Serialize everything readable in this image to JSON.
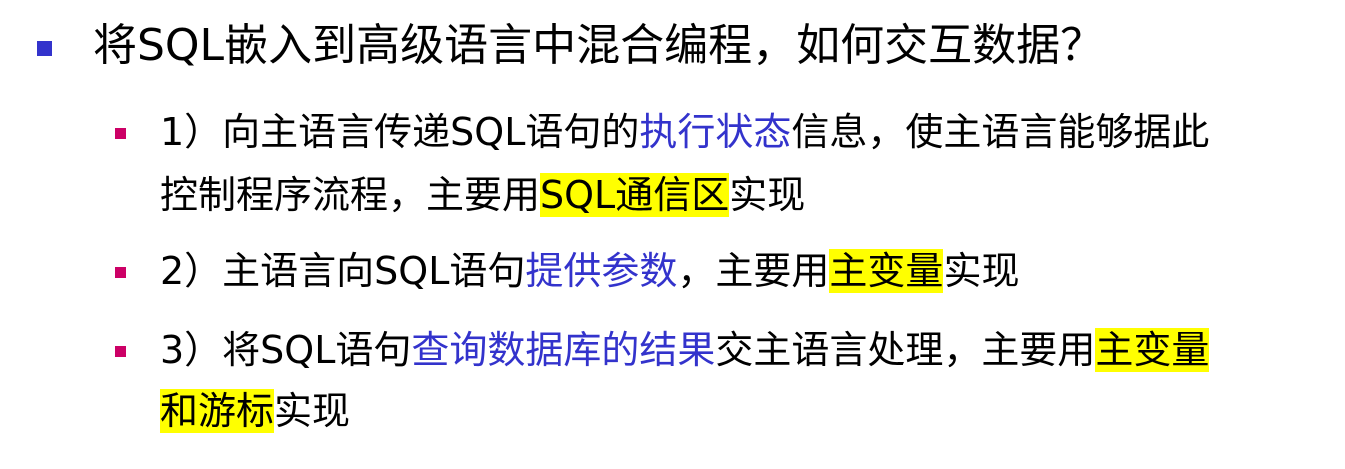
{
  "title": "将SQL嵌入到高级语言中混合编程，如何交互数据？",
  "colors": {
    "main_bullet": "#3333cc",
    "sub_bullet": "#cc0066",
    "emphasis_text": "#3333cc",
    "highlight": "#ffff00"
  },
  "items": [
    {
      "line1": {
        "prefix": "1）向主语言传递SQL语句的",
        "emphasis": "执行状态",
        "suffix": "信息，使主语言能够据此"
      },
      "line2": {
        "prefix": "控制程序流程，主要用",
        "highlight": "SQL通信区",
        "suffix": "实现"
      }
    },
    {
      "line1": {
        "prefix": "2）主语言向SQL语句",
        "emphasis": "提供参数",
        "middle": "，主要用",
        "highlight": "主变量",
        "suffix": "实现"
      }
    },
    {
      "line1": {
        "prefix": "3）将SQL语句",
        "emphasis": "查询数据库的结果",
        "middle": "交主语言处理，主要用",
        "highlight": "主变量"
      },
      "line2": {
        "highlight": "和游标",
        "suffix": "实现"
      }
    }
  ]
}
